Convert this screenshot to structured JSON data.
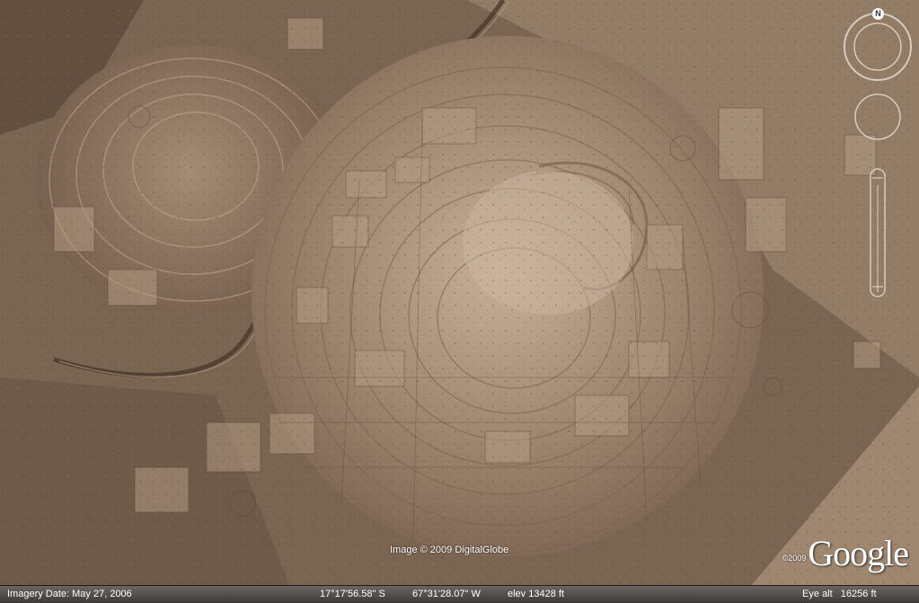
{
  "nav": {
    "compass_letter": "N",
    "icons": [
      "north-compass-icon",
      "look-joystick-icon",
      "move-joystick-icon",
      "zoom-slider-icon"
    ]
  },
  "attribution": "Image © 2009 DigitalGlobe",
  "logo": {
    "year": "©2009",
    "word": "Google"
  },
  "status": {
    "imagery_date": "Imagery Date: May 27, 2006",
    "latitude": "17°17'56.58\" S",
    "longitude": "67°31'28.07\" W",
    "elevation": "elev 13428 ft",
    "eye_alt": "Eye alt   16256 ft"
  },
  "colors": {
    "terrain_base": "#7a6552",
    "terrain_light": "#b49c84",
    "terrain_dark": "#4f3f33",
    "statusbar": "#4a4541"
  }
}
